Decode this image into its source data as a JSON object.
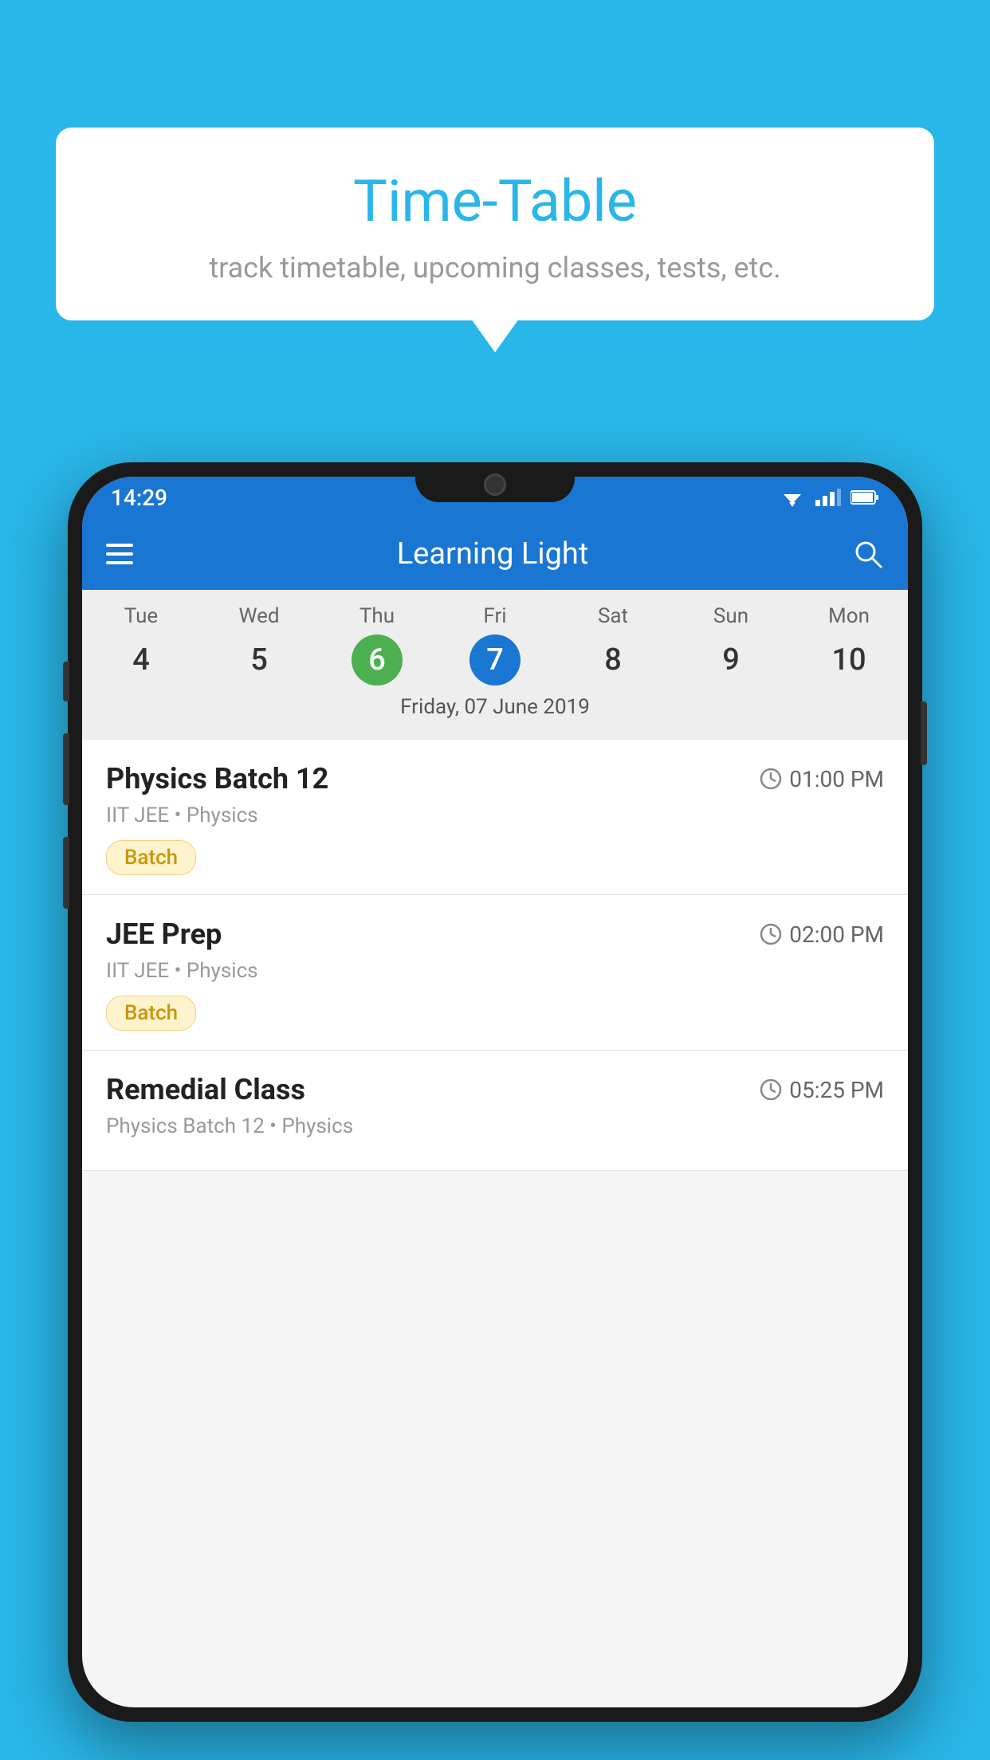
{
  "background_color": "#29b6e8",
  "bubble": {
    "title": "Time-Table",
    "subtitle": "track timetable, upcoming classes, tests, etc."
  },
  "phone": {
    "status_bar": {
      "time": "14:29"
    },
    "app_bar": {
      "title": "Learning Light",
      "menu_label": "menu",
      "search_label": "search"
    },
    "calendar": {
      "days": [
        "Tue",
        "Wed",
        "Thu",
        "Fri",
        "Sat",
        "Sun",
        "Mon"
      ],
      "dates": [
        "4",
        "5",
        "6",
        "7",
        "8",
        "9",
        "10"
      ],
      "today_index": 2,
      "selected_index": 3,
      "selected_date_label": "Friday, 07 June 2019"
    },
    "schedule": [
      {
        "title": "Physics Batch 12",
        "time": "01:00 PM",
        "subtitle": "IIT JEE • Physics",
        "tag": "Batch"
      },
      {
        "title": "JEE Prep",
        "time": "02:00 PM",
        "subtitle": "IIT JEE • Physics",
        "tag": "Batch"
      },
      {
        "title": "Remedial Class",
        "time": "05:25 PM",
        "subtitle": "Physics Batch 12 • Physics",
        "tag": ""
      }
    ]
  }
}
